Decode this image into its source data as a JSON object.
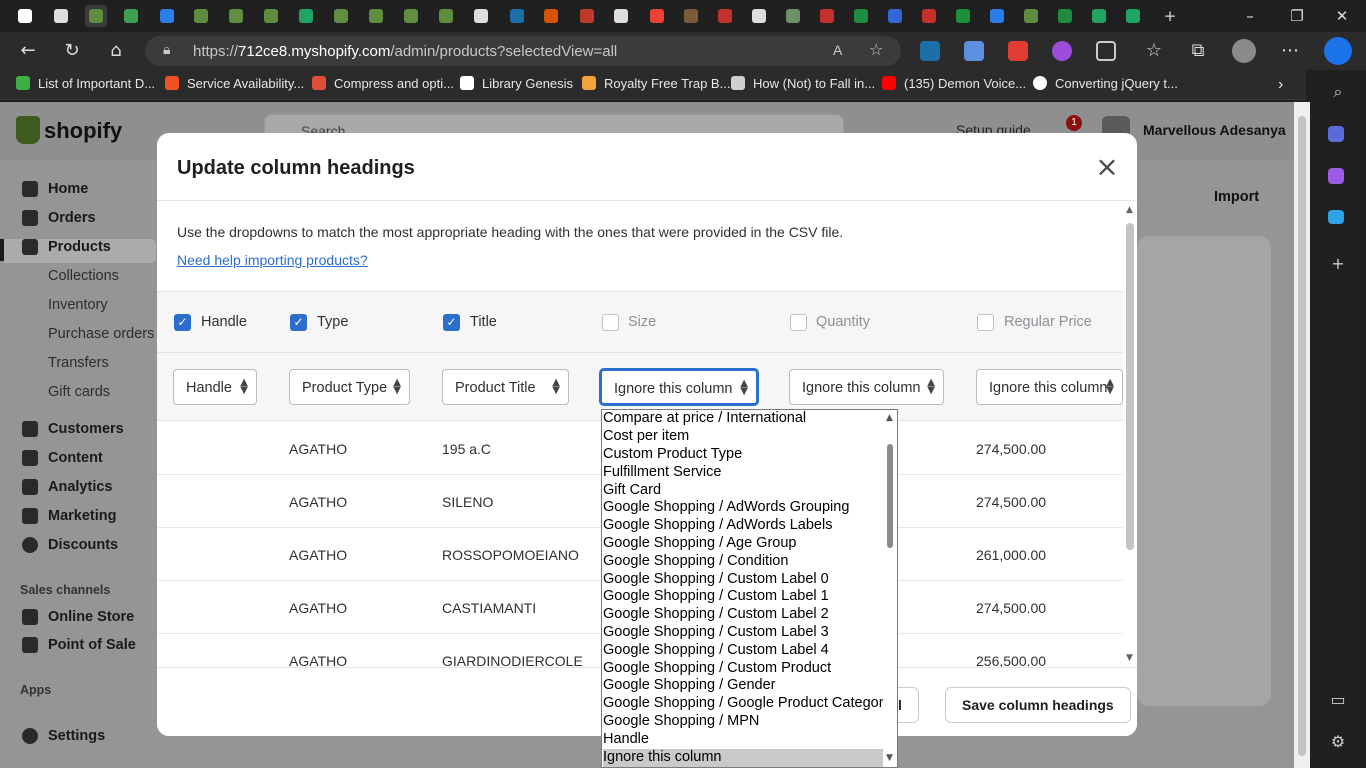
{
  "browser": {
    "url_host": "712ce8.myshopify.com",
    "url_prefix": "https://",
    "url_path": "/admin/products?selectedView=all",
    "bookmarks": [
      {
        "label": "List of Important D...",
        "color": "#3cb043"
      },
      {
        "label": "Service Availability...",
        "color": "#f25022"
      },
      {
        "label": "Compress and opti...",
        "color": "#e04e39"
      },
      {
        "label": "Library Genesis",
        "color": "#ffffff"
      },
      {
        "label": "Royalty Free Trap B...",
        "color": "#f2a33a"
      },
      {
        "label": "How (Not) to Fall in...",
        "color": "#cfcfcf"
      },
      {
        "label": "(135) Demon Voice...",
        "color": "#ff0000"
      },
      {
        "label": "Converting jQuery t...",
        "color": "#ffffff"
      }
    ]
  },
  "shopify": {
    "logo": "shopify",
    "search_placeholder": "Search",
    "setup_guide": "Setup guide",
    "notification_count": "1",
    "user_name": "Marvellous Adesanya",
    "import_label": "Import",
    "nav": [
      {
        "label": "Home",
        "main": true
      },
      {
        "label": "Orders",
        "main": true
      },
      {
        "label": "Products",
        "main": true,
        "active": true
      },
      {
        "label": "Collections",
        "main": false
      },
      {
        "label": "Inventory",
        "main": false
      },
      {
        "label": "Purchase orders",
        "main": false
      },
      {
        "label": "Transfers",
        "main": false
      },
      {
        "label": "Gift cards",
        "main": false
      },
      {
        "label": "Customers",
        "main": true
      },
      {
        "label": "Content",
        "main": true
      },
      {
        "label": "Analytics",
        "main": true
      },
      {
        "label": "Marketing",
        "main": true
      },
      {
        "label": "Discounts",
        "main": true
      }
    ],
    "sales_channels_label": "Sales channels",
    "sales_channels": [
      "Online Store",
      "Point of Sale"
    ],
    "apps_label": "Apps",
    "settings_label": "Settings"
  },
  "modal": {
    "title": "Update column headings",
    "intro": "Use the dropdowns to match the most appropriate heading with the ones that were provided in the CSV file.",
    "help_link": "Need help importing products?",
    "columns": [
      {
        "csv_heading": "Handle",
        "checked": true,
        "mapped_to": "Handle"
      },
      {
        "csv_heading": "Type",
        "checked": true,
        "mapped_to": "Product Type"
      },
      {
        "csv_heading": "Title",
        "checked": true,
        "mapped_to": "Product Title"
      },
      {
        "csv_heading": "Size",
        "checked": false,
        "mapped_to": "Ignore this column"
      },
      {
        "csv_heading": "Quantity",
        "checked": false,
        "mapped_to": "Ignore this column"
      },
      {
        "csv_heading": "Regular Price",
        "checked": false,
        "mapped_to": "Ignore this column"
      }
    ],
    "rows": [
      {
        "type": "AGATHO",
        "title": "195 a.C",
        "price": "274,500.00"
      },
      {
        "type": "AGATHO",
        "title": "SILENO",
        "price": "274,500.00"
      },
      {
        "type": "AGATHO",
        "title": "ROSSOPOMOEIANO",
        "price": "261,000.00"
      },
      {
        "type": "AGATHO",
        "title": "CASTIAMANTI",
        "price": "274,500.00"
      },
      {
        "type": "AGATHO",
        "title": "GIARDINODIERCOLE",
        "price": "256,500.00"
      }
    ],
    "cancel_label": "Cancel",
    "save_label": "Save column headings"
  },
  "dropdown": {
    "options": [
      "Compare at price / International",
      "Cost per item",
      "Custom Product Type",
      "Fulfillment Service",
      "Gift Card",
      "Google Shopping / AdWords Grouping",
      "Google Shopping / AdWords Labels",
      "Google Shopping / Age Group",
      "Google Shopping / Condition",
      "Google Shopping / Custom Label 0",
      "Google Shopping / Custom Label 1",
      "Google Shopping / Custom Label 2",
      "Google Shopping / Custom Label 3",
      "Google Shopping / Custom Label 4",
      "Google Shopping / Custom Product",
      "Google Shopping / Gender",
      "Google Shopping / Google Product Category",
      "Google Shopping / MPN",
      "Handle",
      "Ignore this column"
    ],
    "highlighted": "Ignore this column"
  }
}
